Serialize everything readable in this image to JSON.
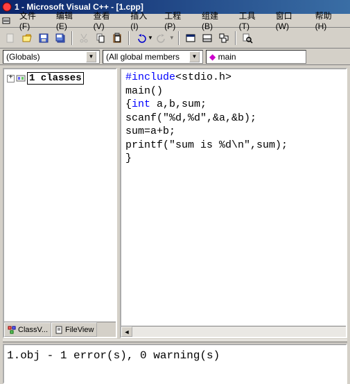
{
  "title": "1 - Microsoft Visual C++ - [1.cpp]",
  "menu": {
    "file": "文件(F)",
    "edit": "编辑(E)",
    "view": "查看(V)",
    "insert": "插入(I)",
    "project": "工程(P)",
    "build": "组建(B)",
    "tools": "工具(T)",
    "window": "窗口(W)",
    "help": "帮助(H)"
  },
  "combo": {
    "scope": "(Globals)",
    "members": "(All global members",
    "func_icon": "◆",
    "func": "main"
  },
  "tree": {
    "root": "1 classes"
  },
  "tabs": {
    "classview": "ClassV...",
    "fileview": "FileView"
  },
  "code": {
    "l1a": "#include",
    "l1b": "<stdio.h>",
    "l2": "main()",
    "l3a": "{",
    "l3b": "int",
    "l3c": " a,b,sum;",
    "l4": "scanf(\"%d,%d\",&a,&b);",
    "l5": "sum=a+b;",
    "l6": "printf(\"sum is %d\\n\",sum);",
    "l7": "}"
  },
  "output": "1.obj - 1 error(s), 0 warning(s)"
}
